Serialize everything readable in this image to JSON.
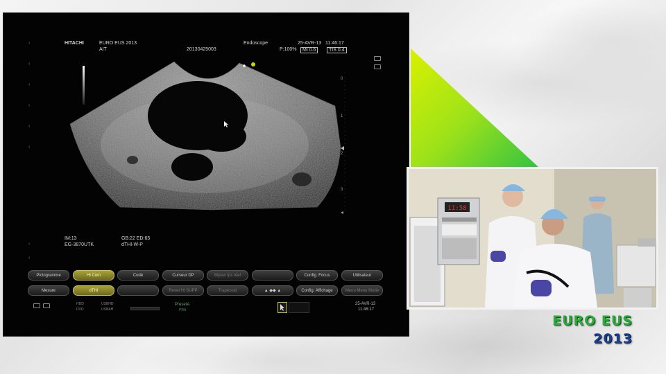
{
  "logo": {
    "line1": "EURO EUS",
    "line2": "2013"
  },
  "scanner": {
    "brand": "HITACHI",
    "event": "EURO EUS 2013",
    "institution": "AIT",
    "study_id": "20130425003",
    "probe_mode": "Endoscope",
    "date": "25-AVR-13",
    "time": "11:46:17",
    "power": "P:100%",
    "mi": "MI 0.6",
    "tis": "TIS 0.4",
    "image_info": {
      "im": "IM:13",
      "gb_ed": "GB:22  ED:65",
      "probe": "EG-3870UTK",
      "preset": "dTHI-W-P"
    },
    "depth_ticks": [
      "0",
      "1",
      "2",
      "3"
    ]
  },
  "controls": {
    "row1": [
      {
        "label": "Pictogramme",
        "state": "normal"
      },
      {
        "label": "HI Com",
        "state": "active"
      },
      {
        "label": "Codé",
        "state": "normal"
      },
      {
        "label": "Curseur DP",
        "state": "normal"
      },
      {
        "label": "Biplan tps réel",
        "state": "dim"
      },
      {
        "label": "",
        "state": "dim"
      },
      {
        "label": "Config. Focus",
        "state": "normal"
      },
      {
        "label": "Utilisateur",
        "state": "normal"
      }
    ],
    "row2": [
      {
        "label": "Mesure",
        "state": "normal"
      },
      {
        "label": "dTHI",
        "state": "active"
      },
      {
        "label": "",
        "state": "normal"
      },
      {
        "label": "Reset HI SUPP",
        "state": "dim"
      },
      {
        "label": "Trapezoid",
        "state": "dim"
      },
      {
        "label": "▲ ◆◆ ▲",
        "state": "normal"
      },
      {
        "label": "Config. Affichage",
        "state": "normal"
      },
      {
        "label": "Menu Menu Mode",
        "state": "dim"
      }
    ]
  },
  "status": {
    "hdd": "HDD",
    "dvd": "DVD",
    "usbhd": "USBHD",
    "usbah": "USBAH",
    "preset_label": "PresetA",
    "preset_sub": "PRA",
    "date": "25-AVR-13",
    "time": "11:46:17"
  },
  "video": {
    "wall_clock": "11:58"
  }
}
